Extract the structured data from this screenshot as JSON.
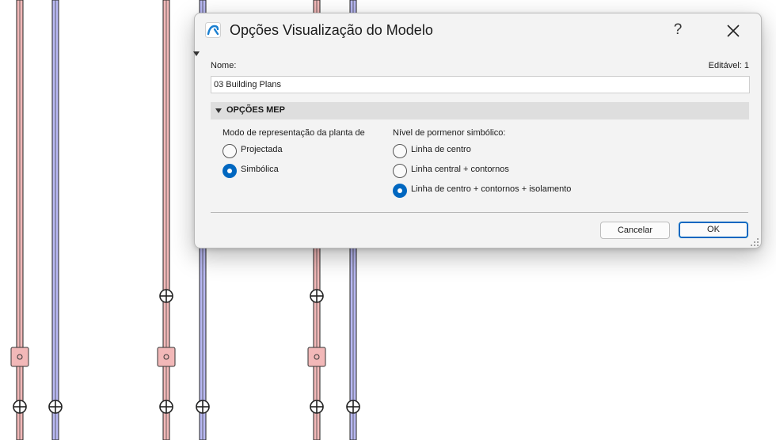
{
  "dialog": {
    "title": "Opções Visualização do Modelo",
    "help_label": "?",
    "name_label": "Nome:",
    "editable_label": "Editável: 1",
    "name_value": "03 Building Plans",
    "section_title": "OPÇÕES MEP",
    "mode_group": {
      "label": "Modo de representação da planta de",
      "options": [
        {
          "label": "Projectada",
          "selected": false
        },
        {
          "label": "Simbólica",
          "selected": true
        }
      ]
    },
    "detail_group": {
      "label": "Nível de pormenor simbólico:",
      "options": [
        {
          "label": "Linha de centro",
          "selected": false
        },
        {
          "label": "Linha central + contornos",
          "selected": false
        },
        {
          "label": "Linha de centro + contornos + isolamento",
          "selected": true
        }
      ]
    },
    "cancel_label": "Cancelar",
    "ok_label": "OK"
  },
  "colors": {
    "accent": "#0067c0",
    "pipe_red": "#f2b8b8",
    "pipe_blue": "#b8b8f2"
  }
}
